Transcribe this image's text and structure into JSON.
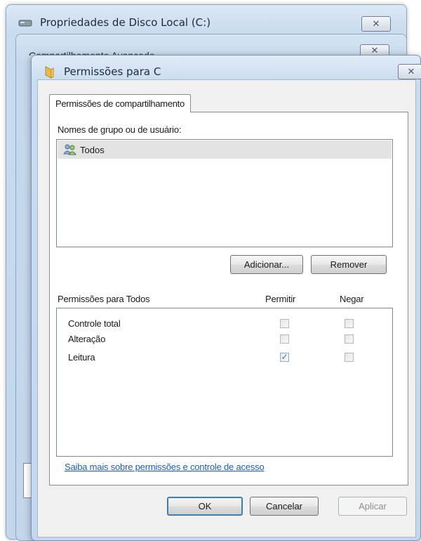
{
  "back_window": {
    "title": "Propriedades de Disco Local (C:)",
    "close_glyph": "✕"
  },
  "middle_window": {
    "title_partial": "Compartilhamento Avançado",
    "close_glyph": "✕"
  },
  "dialog": {
    "title": "Permissões para C",
    "close_glyph": "✕",
    "tab_label": "Permissões de compartilhamento",
    "group_label": "Nomes de grupo ou de usuário:",
    "groups": [
      {
        "name": "Todos",
        "icon": "users-icon"
      }
    ],
    "add_button": "Adicionar...",
    "remove_button": "Remover",
    "permissions_header": "Permissões para Todos",
    "allow_header": "Permitir",
    "deny_header": "Negar",
    "permissions": [
      {
        "name": "Controle total",
        "allow": false,
        "deny": false
      },
      {
        "name": "Alteração",
        "allow": false,
        "deny": false
      },
      {
        "name": "Leitura",
        "allow": true,
        "deny": false
      }
    ],
    "learn_more_link": "Saiba mais sobre permissões e controle de acesso",
    "ok_button": "OK",
    "cancel_button": "Cancelar",
    "apply_button": "Aplicar"
  },
  "colors": {
    "link": "#1a5fb4",
    "selection": "#e3e3e3",
    "frame": "#c4d7eb"
  }
}
